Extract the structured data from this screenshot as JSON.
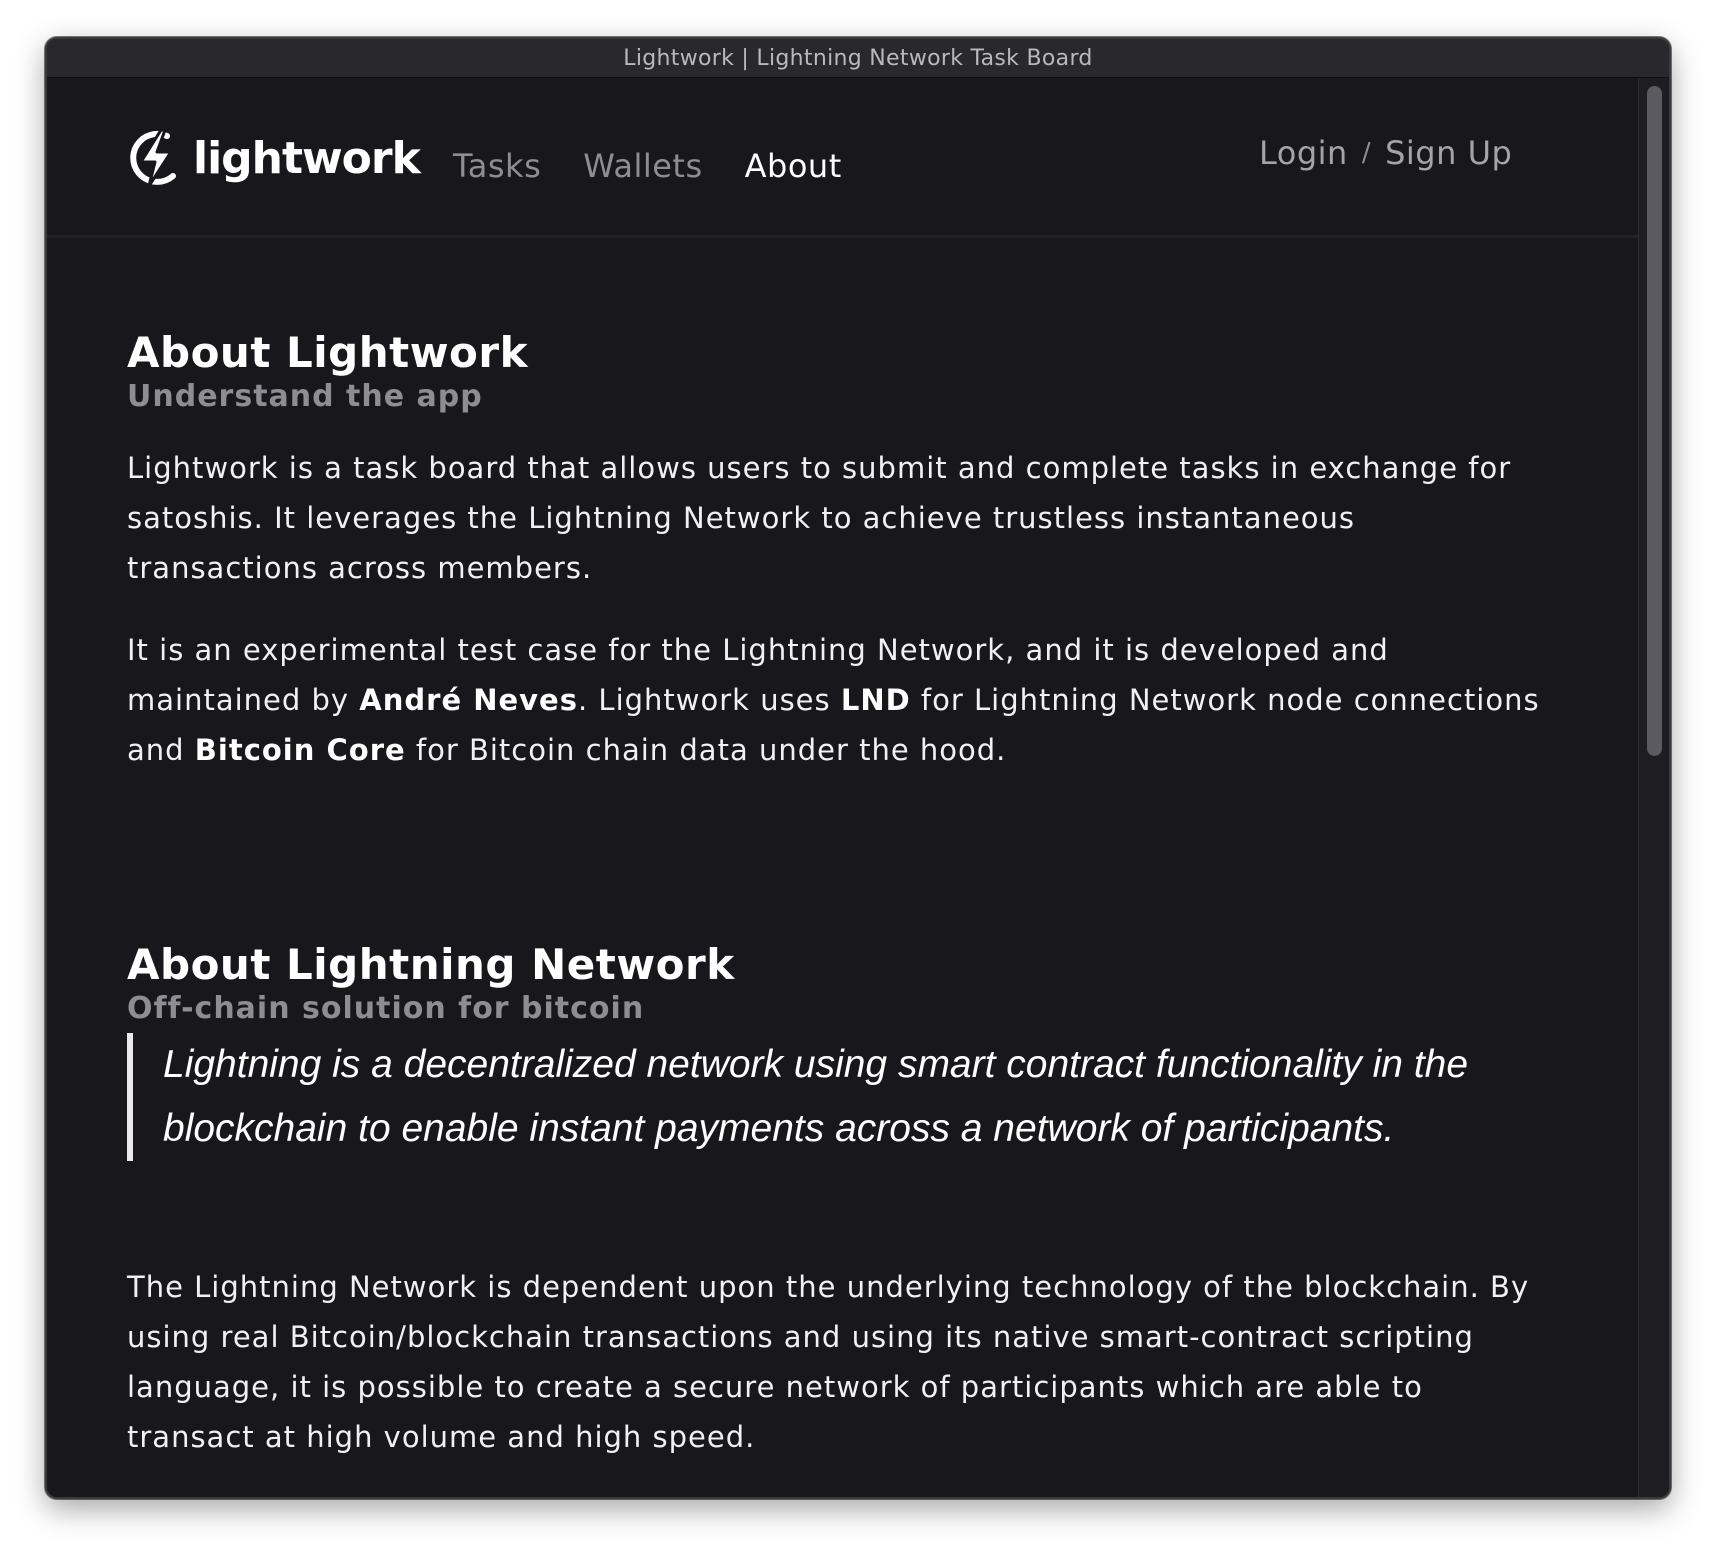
{
  "window": {
    "title": "Lightwork | Lightning Network Task Board"
  },
  "navbar": {
    "brand": "lightwork",
    "brand_icon": "lightning-bolt-icon",
    "links": [
      {
        "label": "Tasks",
        "active": false
      },
      {
        "label": "Wallets",
        "active": false
      },
      {
        "label": "About",
        "active": true
      }
    ],
    "login_label": "Login",
    "separator": "/",
    "signup_label": "Sign Up"
  },
  "about_lightwork": {
    "title": "About Lightwork",
    "subtitle": "Understand the app",
    "paragraph1": "Lightwork is a task board that allows users to submit and complete tasks in exchange for satoshis. It leverages the Lightning Network to achieve trustless instantaneous transactions across members.",
    "paragraph2": {
      "part1": "It is an experimental test case for the Lightning Network, and it is developed and maintained by ",
      "bold1": "André Neves",
      "part2": ". Lightwork uses ",
      "bold2": "LND",
      "part3": " for Lightning Network node connections and ",
      "bold3": "Bitcoin Core",
      "part4": " for Bitcoin chain data under the hood."
    }
  },
  "about_lightning": {
    "title": "About Lightning Network",
    "subtitle": "Off-chain solution for bitcoin",
    "quote": "Lightning is a decentralized network using smart contract functionality in the blockchain to enable instant payments across a network of participants.",
    "paragraph": "The Lightning Network is dependent upon the underlying technology of the blockchain. By using real Bitcoin/blockchain transactions and using its native smart-contract scripting language, it is possible to create a secure network of participants which are able to transact at high volume and high speed."
  },
  "colors": {
    "background": "#18171c",
    "text": "#f1f1f3",
    "muted": "#8e8d93",
    "titlebar": "#29282c"
  }
}
